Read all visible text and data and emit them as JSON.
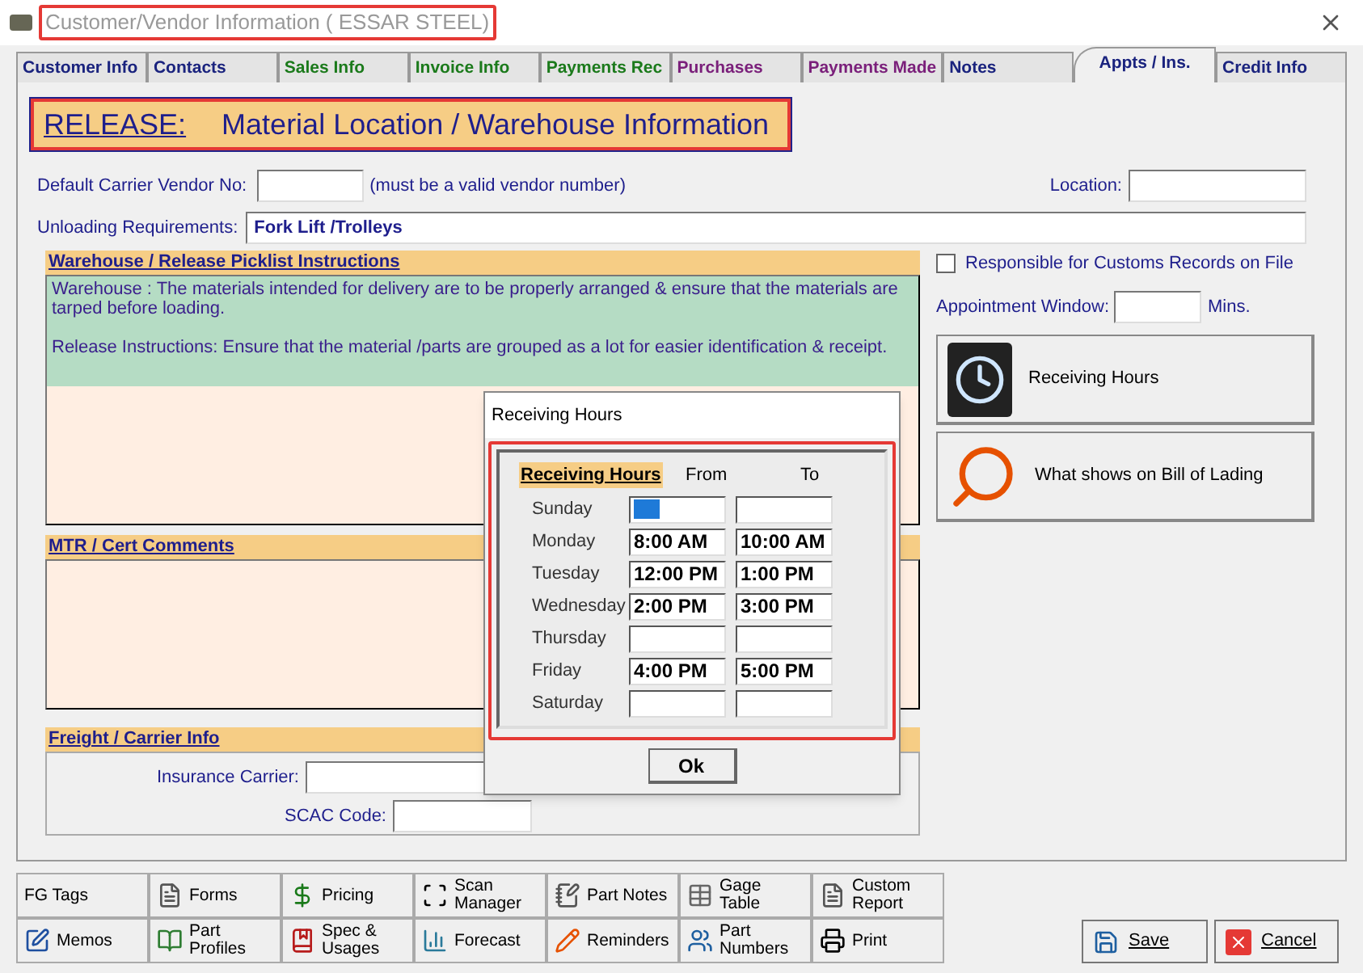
{
  "window": {
    "title": "Customer/Vendor Information  ( ESSAR STEEL)"
  },
  "tabs": [
    {
      "label": "Customer Info",
      "selected": false,
      "color": "#1a237e"
    },
    {
      "label": "Contacts",
      "selected": false,
      "color": "#1a237e"
    },
    {
      "label": "Sales Info",
      "selected": false,
      "color": "#1b7a1b"
    },
    {
      "label": "Invoice Info",
      "selected": false,
      "color": "#1b7a1b"
    },
    {
      "label": "Payments Rec",
      "selected": false,
      "color": "#1b7a1b"
    },
    {
      "label": "Purchases",
      "selected": false,
      "color": "#7a1f7a"
    },
    {
      "label": "Payments Made",
      "selected": false,
      "color": "#7a1f7a"
    },
    {
      "label": "Notes",
      "selected": false,
      "color": "#1a237e"
    },
    {
      "label": "Appts / Ins.",
      "selected": true,
      "color": "#1a237e"
    },
    {
      "label": "Credit Info",
      "selected": false,
      "color": "#1a237e"
    }
  ],
  "banner": {
    "lead": "RELEASE:",
    "title": "Material Location / Warehouse Information"
  },
  "carrier_vendor": {
    "label": "Default Carrier Vendor No:",
    "hint": "(must be a valid vendor number)"
  },
  "location": {
    "label": "Location:"
  },
  "unloading": {
    "label": "Unloading Requirements:",
    "value": "Fork Lift /Trolleys"
  },
  "warehouse": {
    "heading": "Warehouse / Release Picklist Instructions",
    "lines": [
      "Warehouse : The materials intended for delivery are to be properly arranged & ensure that the materials are tarped before loading.",
      "Release Instructions: Ensure that the material /parts are grouped as a lot for easier identification & receipt."
    ]
  },
  "mtr": {
    "heading": "MTR / Cert Comments"
  },
  "freight": {
    "heading": "Freight / Carrier Info",
    "fields": [
      "Insurance Carrier:",
      "SCAC Code:"
    ]
  },
  "customs": {
    "label": "Responsible for Customs Records on File",
    "checked": false
  },
  "appointment": {
    "label": "Appointment Window:",
    "unit": "Mins."
  },
  "side_buttons": [
    "Receiving Hours",
    "What shows on Bill of Lading"
  ],
  "dialog": {
    "title": "Receiving Hours",
    "heading": "Receiving Hours",
    "from": "From",
    "to": "To",
    "days": [
      {
        "day": "Sunday",
        "focused": true
      },
      {
        "day": "Monday",
        "from": "8:00 AM",
        "to": "10:00 AM",
        "focused": false
      },
      {
        "day": "Tuesday",
        "from": "12:00 PM",
        "to": "1:00 PM",
        "focused": false
      },
      {
        "day": "Wednesday",
        "from": "2:00 PM",
        "to": "3:00 PM",
        "focused": false
      },
      {
        "day": "Thursday",
        "focused": false
      },
      {
        "day": "Friday",
        "from": "4:00 PM",
        "to": "5:00 PM",
        "focused": false
      },
      {
        "day": "Saturday",
        "focused": false
      }
    ],
    "ok": "Ok"
  },
  "toolbar": [
    [
      "FG Tags",
      "Forms",
      "Pricing",
      "Scan Manager",
      "Part Notes",
      "Gage Table",
      "Custom Report"
    ],
    [
      "Memos",
      "Part Profiles",
      "Spec & Usages",
      "Forecast",
      "Reminders",
      "Part Numbers",
      "Print"
    ]
  ],
  "save": "Save",
  "cancel": "Cancel"
}
